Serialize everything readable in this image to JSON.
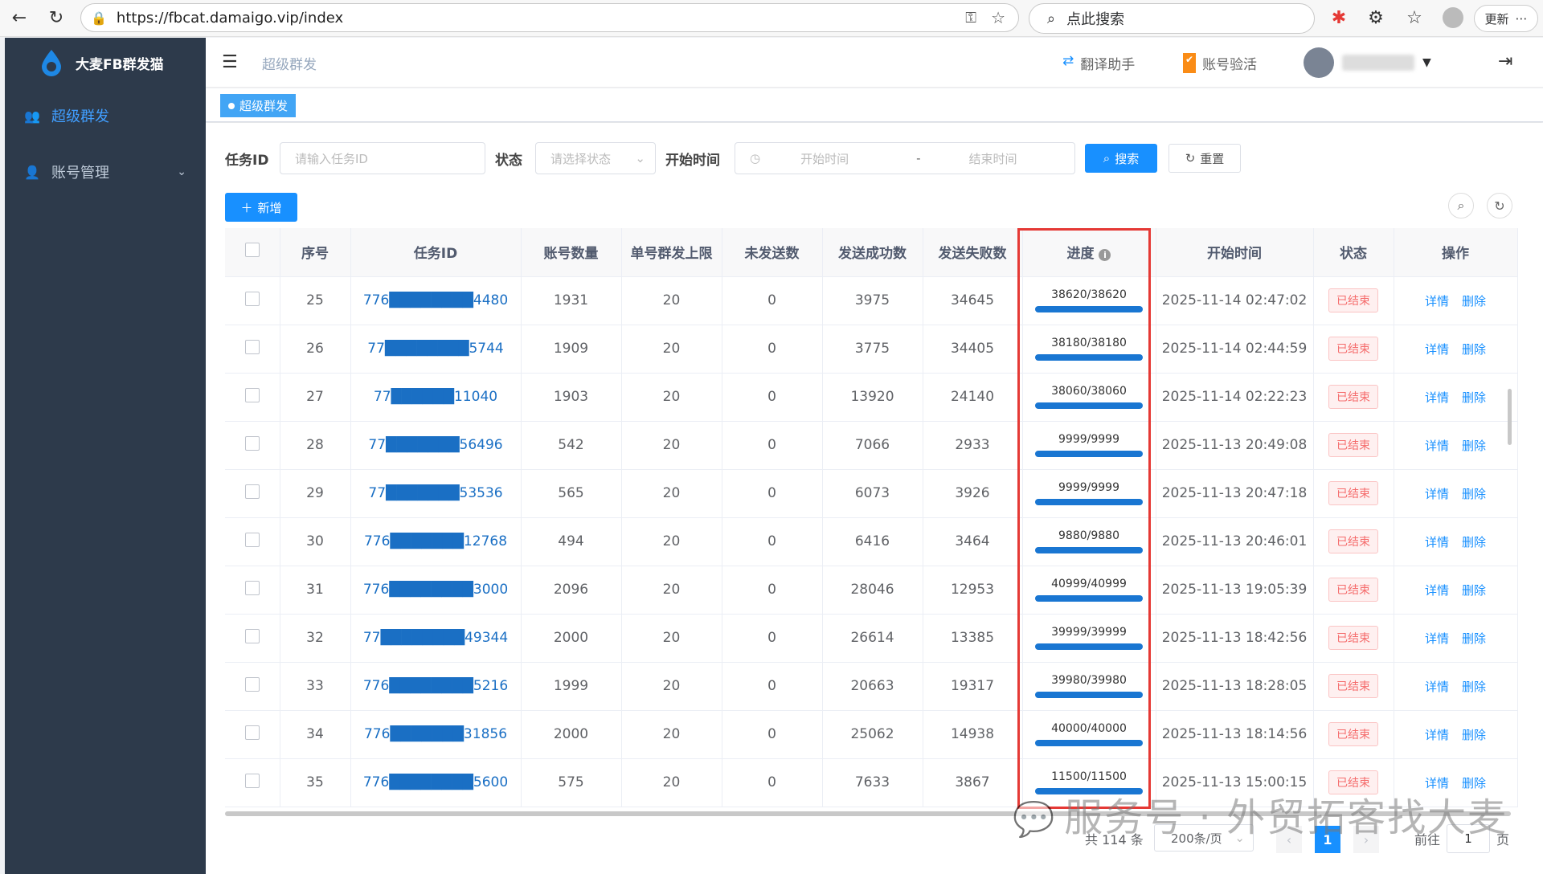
{
  "browser": {
    "url": "https://fbcat.damaigo.vip/index",
    "search_placeholder": "点此搜索",
    "update_label": "更新"
  },
  "app": {
    "title": "大麦FB群发猫"
  },
  "sidebar": {
    "items": [
      {
        "label": "超级群发",
        "active": true
      },
      {
        "label": "账号管理",
        "active": false
      }
    ]
  },
  "header": {
    "breadcrumb": "超级群发",
    "translate_label": "翻译助手",
    "verify_label": "账号验活"
  },
  "tags": {
    "active": "超级群发"
  },
  "filters": {
    "task_id_label": "任务ID",
    "task_id_placeholder": "请输入任务ID",
    "status_label": "状态",
    "status_placeholder": "请选择状态",
    "time_label": "开始时间",
    "start_placeholder": "开始时间",
    "range_sep": "-",
    "end_placeholder": "结束时间",
    "search_label": "搜索",
    "reset_label": "重置"
  },
  "toolbar": {
    "add_label": "新增"
  },
  "table": {
    "headers": [
      "序号",
      "任务ID",
      "账号数量",
      "单号群发上限",
      "未发送数",
      "发送成功数",
      "发送失败数",
      "进度",
      "开始时间",
      "状态",
      "操作"
    ],
    "rows": [
      {
        "no": "25",
        "id": "776████████4480",
        "accounts": "1931",
        "limit": "20",
        "unsent": "0",
        "success": "3975",
        "fail": "34645",
        "progress": "38620/38620",
        "time": "2025-11-14 02:47:02",
        "status": "已结束"
      },
      {
        "no": "26",
        "id": "77████████5744",
        "accounts": "1909",
        "limit": "20",
        "unsent": "0",
        "success": "3775",
        "fail": "34405",
        "progress": "38180/38180",
        "time": "2025-11-14 02:44:59",
        "status": "已结束"
      },
      {
        "no": "27",
        "id": "77██████11040",
        "accounts": "1903",
        "limit": "20",
        "unsent": "0",
        "success": "13920",
        "fail": "24140",
        "progress": "38060/38060",
        "time": "2025-11-14 02:22:23",
        "status": "已结束"
      },
      {
        "no": "28",
        "id": "77███████56496",
        "accounts": "542",
        "limit": "20",
        "unsent": "0",
        "success": "7066",
        "fail": "2933",
        "progress": "9999/9999",
        "time": "2025-11-13 20:49:08",
        "status": "已结束"
      },
      {
        "no": "29",
        "id": "77███████53536",
        "accounts": "565",
        "limit": "20",
        "unsent": "0",
        "success": "6073",
        "fail": "3926",
        "progress": "9999/9999",
        "time": "2025-11-13 20:47:18",
        "status": "已结束"
      },
      {
        "no": "30",
        "id": "776███████12768",
        "accounts": "494",
        "limit": "20",
        "unsent": "0",
        "success": "6416",
        "fail": "3464",
        "progress": "9880/9880",
        "time": "2025-11-13 20:46:01",
        "status": "已结束"
      },
      {
        "no": "31",
        "id": "776████████3000",
        "accounts": "2096",
        "limit": "20",
        "unsent": "0",
        "success": "28046",
        "fail": "12953",
        "progress": "40999/40999",
        "time": "2025-11-13 19:05:39",
        "status": "已结束"
      },
      {
        "no": "32",
        "id": "77████████49344",
        "accounts": "2000",
        "limit": "20",
        "unsent": "0",
        "success": "26614",
        "fail": "13385",
        "progress": "39999/39999",
        "time": "2025-11-13 18:42:56",
        "status": "已结束"
      },
      {
        "no": "33",
        "id": "776████████5216",
        "accounts": "1999",
        "limit": "20",
        "unsent": "0",
        "success": "20663",
        "fail": "19317",
        "progress": "39980/39980",
        "time": "2025-11-13 18:28:05",
        "status": "已结束"
      },
      {
        "no": "34",
        "id": "776███████31856",
        "accounts": "2000",
        "limit": "20",
        "unsent": "0",
        "success": "25062",
        "fail": "14938",
        "progress": "40000/40000",
        "time": "2025-11-13 18:14:56",
        "status": "已结束"
      },
      {
        "no": "35",
        "id": "776████████5600",
        "accounts": "575",
        "limit": "20",
        "unsent": "0",
        "success": "7633",
        "fail": "3867",
        "progress": "11500/11500",
        "time": "2025-11-13 15:00:15",
        "status": "已结束"
      }
    ],
    "detail_label": "详情",
    "delete_label": "删除"
  },
  "pagination": {
    "total": "共 114 条",
    "page_size": "200条/页",
    "current": "1",
    "goto_label": "前往",
    "goto_value": "1",
    "page_suffix": "页"
  },
  "watermark": "服务号 · 外贸拓客找大麦",
  "colors": {
    "sidebar": "#2d3a4b",
    "accent": "#1890ff",
    "highlight": "#e53935"
  }
}
